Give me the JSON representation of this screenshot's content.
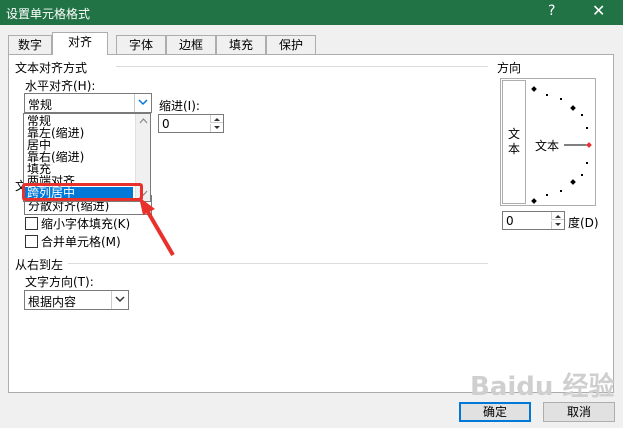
{
  "window": {
    "title": "设置单元格格式",
    "help": "?",
    "close": "✕",
    "title_bar_color": "#217346"
  },
  "tabs": [
    {
      "label": "数字"
    },
    {
      "label": "对齐"
    },
    {
      "label": "字体"
    },
    {
      "label": "边框"
    },
    {
      "label": "填充"
    },
    {
      "label": "保护"
    }
  ],
  "text_alignment": {
    "section_label": "文本对齐方式",
    "horizontal_label": "水平对齐(H):",
    "horizontal_value": "常规",
    "indent_label": "缩进(I):",
    "indent_value": "0",
    "dropdown_options": [
      "常规",
      "靠左(缩进)",
      "居中",
      "靠右(缩进)",
      "填充",
      "两端对齐",
      "跨列居中"
    ],
    "dropdown_selected": "跨列居中",
    "vertical_value": "分散对齐(缩进)",
    "section_obscured": "文"
  },
  "text_control": {
    "shrink_label": "缩小字体填充(K)",
    "merge_label": "合并单元格(M)"
  },
  "rtl": {
    "section_label": "从右到左",
    "direction_label": "文字方向(T):",
    "direction_value": "根据内容"
  },
  "orientation": {
    "section_label": "方向",
    "vertical_text": [
      "文",
      "本"
    ],
    "horizontal_text": "文本",
    "degrees_value": "0",
    "degrees_label": "度(D)"
  },
  "buttons": {
    "ok": "确定",
    "cancel": "取消"
  },
  "watermark": "Baidu 经验",
  "colors": {
    "highlight": "#e8302c",
    "selection": "#0078d7"
  }
}
